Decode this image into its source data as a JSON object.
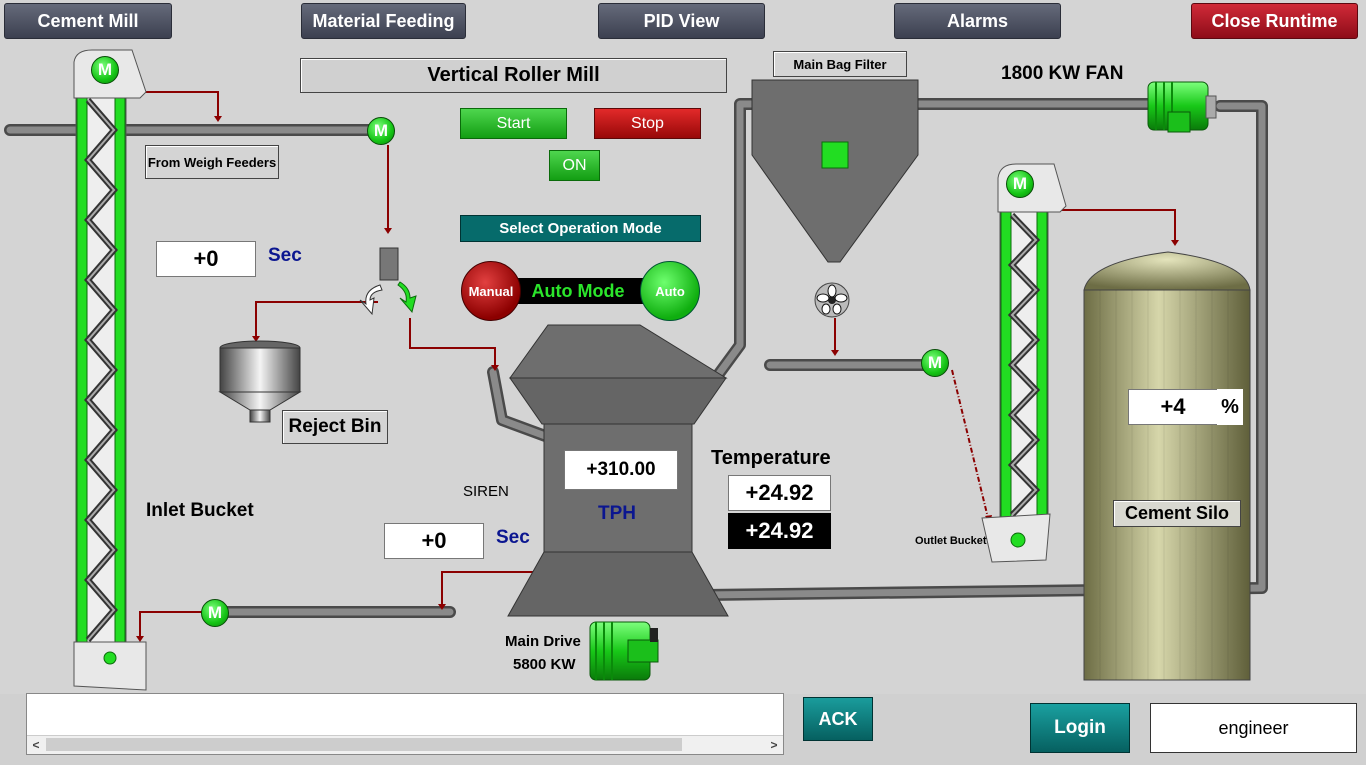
{
  "nav": {
    "cement_mill": "Cement Mill",
    "material_feeding": "Material Feeding",
    "pid_view": "PID View",
    "alarms": "Alarms",
    "close_runtime": "Close Runtime"
  },
  "mill": {
    "title": "Vertical Roller Mill",
    "start_label": "Start",
    "stop_label": "Stop",
    "status": "ON",
    "select_mode_label": "Select Operation Mode",
    "manual_label": "Manual",
    "auto_label": "Auto",
    "mode_text": "Auto Mode",
    "tph_value": "+310.00",
    "tph_unit": "TPH",
    "main_drive_label": "Main Drive",
    "main_drive_power": "5800 KW"
  },
  "feed": {
    "from_weigh_feeders": "From Weigh Feeders",
    "timer1_value": "+0",
    "timer1_unit": "Sec",
    "reject_bin": "Reject Bin",
    "inlet_bucket": "Inlet Bucket",
    "siren": "SIREN",
    "timer2_value": "+0",
    "timer2_unit": "Sec"
  },
  "temperature": {
    "label": "Temperature",
    "value1": "+24.92",
    "value2": "+24.92"
  },
  "filter": {
    "bag_filter": "Main Bag Filter",
    "fan_label": "1800 KW FAN"
  },
  "silo": {
    "level_value": "+4",
    "level_unit": "%",
    "label": "Cement Silo",
    "outlet_bucket": "Outlet Bucket"
  },
  "motor_label": "M",
  "bottom": {
    "ack": "ACK",
    "login": "Login",
    "user": "engineer",
    "scroll_left": "<",
    "scroll_right": ">"
  },
  "colors": {
    "running_green": "#22dd22",
    "pipe_gray": "#6e6e6e",
    "signal_red": "#8b0000"
  }
}
